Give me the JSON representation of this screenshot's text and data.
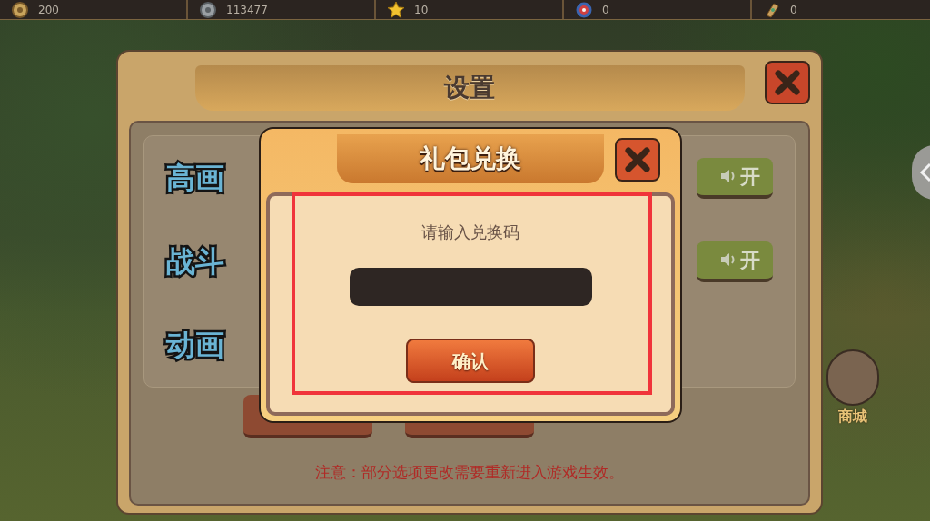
{
  "resources": [
    {
      "kind": "gold-coin",
      "value": "200"
    },
    {
      "kind": "silver-coin",
      "value": "113477"
    },
    {
      "kind": "star",
      "value": "10"
    },
    {
      "kind": "emblem",
      "value": "0"
    },
    {
      "kind": "scroll",
      "value": "0"
    }
  ],
  "settings": {
    "title": "设置",
    "options": [
      {
        "label": "高画",
        "toggle": "开"
      },
      {
        "label": "战斗",
        "toggle": "开"
      },
      {
        "label": "动画"
      }
    ],
    "notice": "注意：部分选项更改需要重新进入游戏生效。"
  },
  "shop": {
    "label": "商城"
  },
  "dialog": {
    "title": "礼包兑换",
    "prompt": "请输入兑换码",
    "confirm": "确认"
  }
}
